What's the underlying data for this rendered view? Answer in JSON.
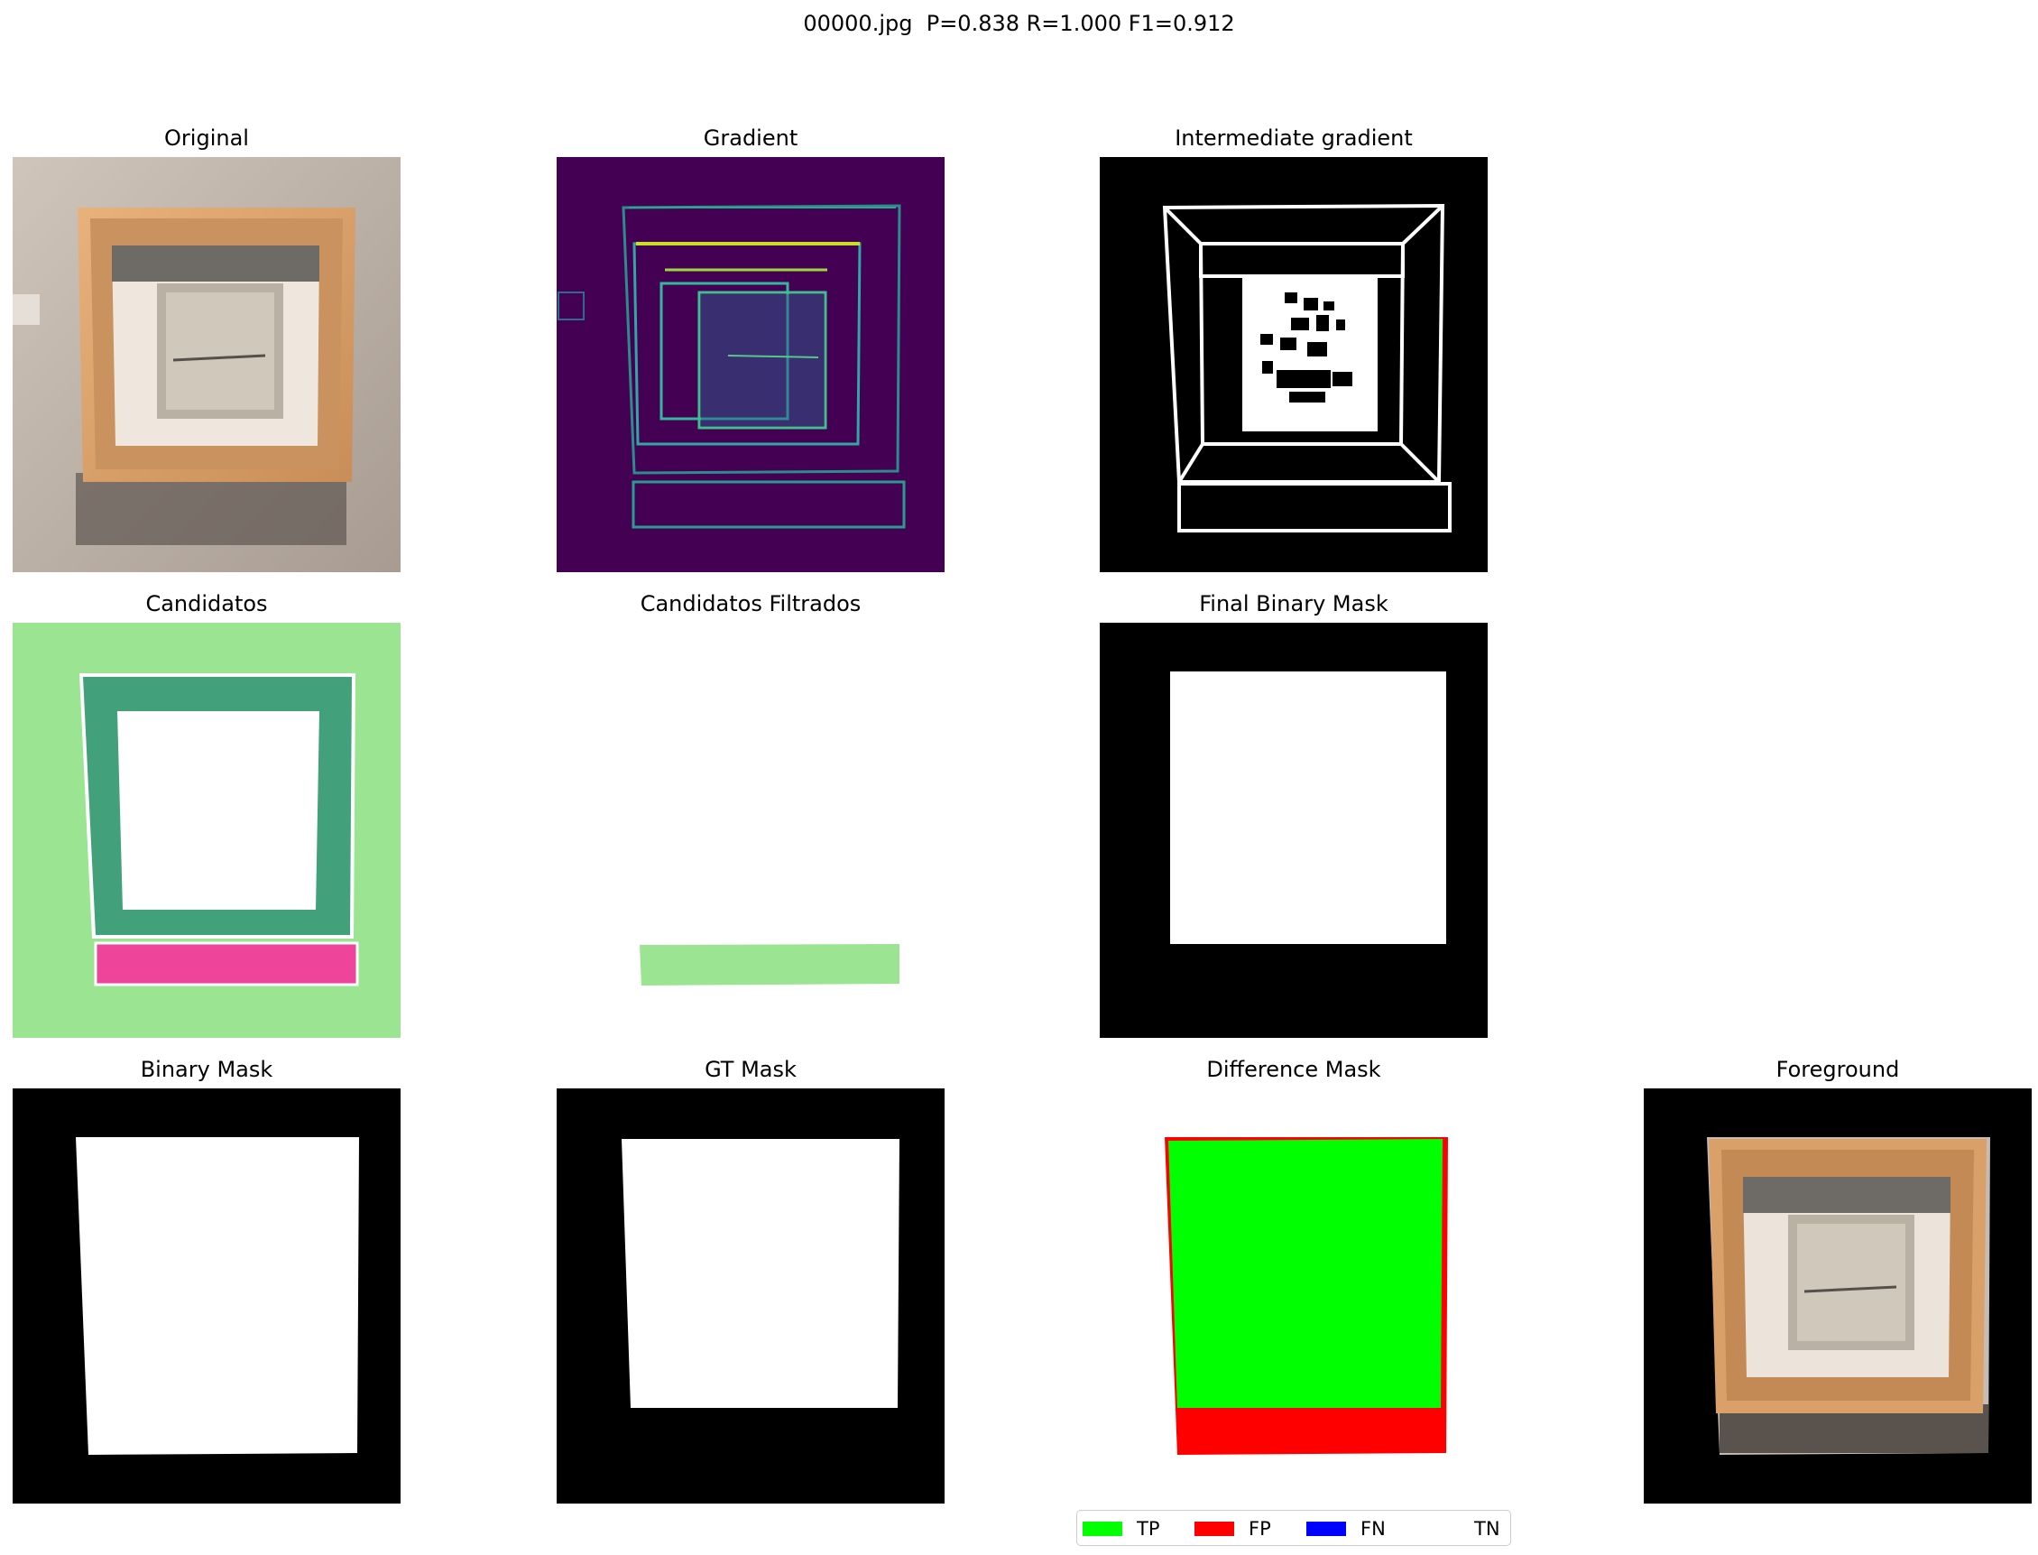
{
  "figure": {
    "suptitle": "00000.jpg  P=0.838 R=1.000 F1=0.912"
  },
  "panels": {
    "original": "Original",
    "gradient": "Gradient",
    "intermediate": "Intermediate gradient",
    "candidatos": "Candidatos",
    "filtrados": "Candidatos Filtrados",
    "final_mask": "Final Binary Mask",
    "binary_mask": "Binary Mask",
    "gt_mask": "GT Mask",
    "difference": "Difference Mask",
    "foreground": "Foreground"
  },
  "legend": {
    "items": [
      {
        "label": "TP",
        "color": "#00ff00"
      },
      {
        "label": "FP",
        "color": "#ff0000"
      },
      {
        "label": "FN",
        "color": "#0000ff"
      },
      {
        "label": "TN",
        "color": "#ffffff"
      }
    ]
  },
  "colors": {
    "tp": "#00ff00",
    "fp": "#ff0000",
    "fn": "#0000ff",
    "tn": "#ffffff",
    "candidate_bg": "#9be491",
    "candidate_frame": "#42a07b",
    "candidate_pink": "#ee449a",
    "gradient_bg": "#440154"
  }
}
